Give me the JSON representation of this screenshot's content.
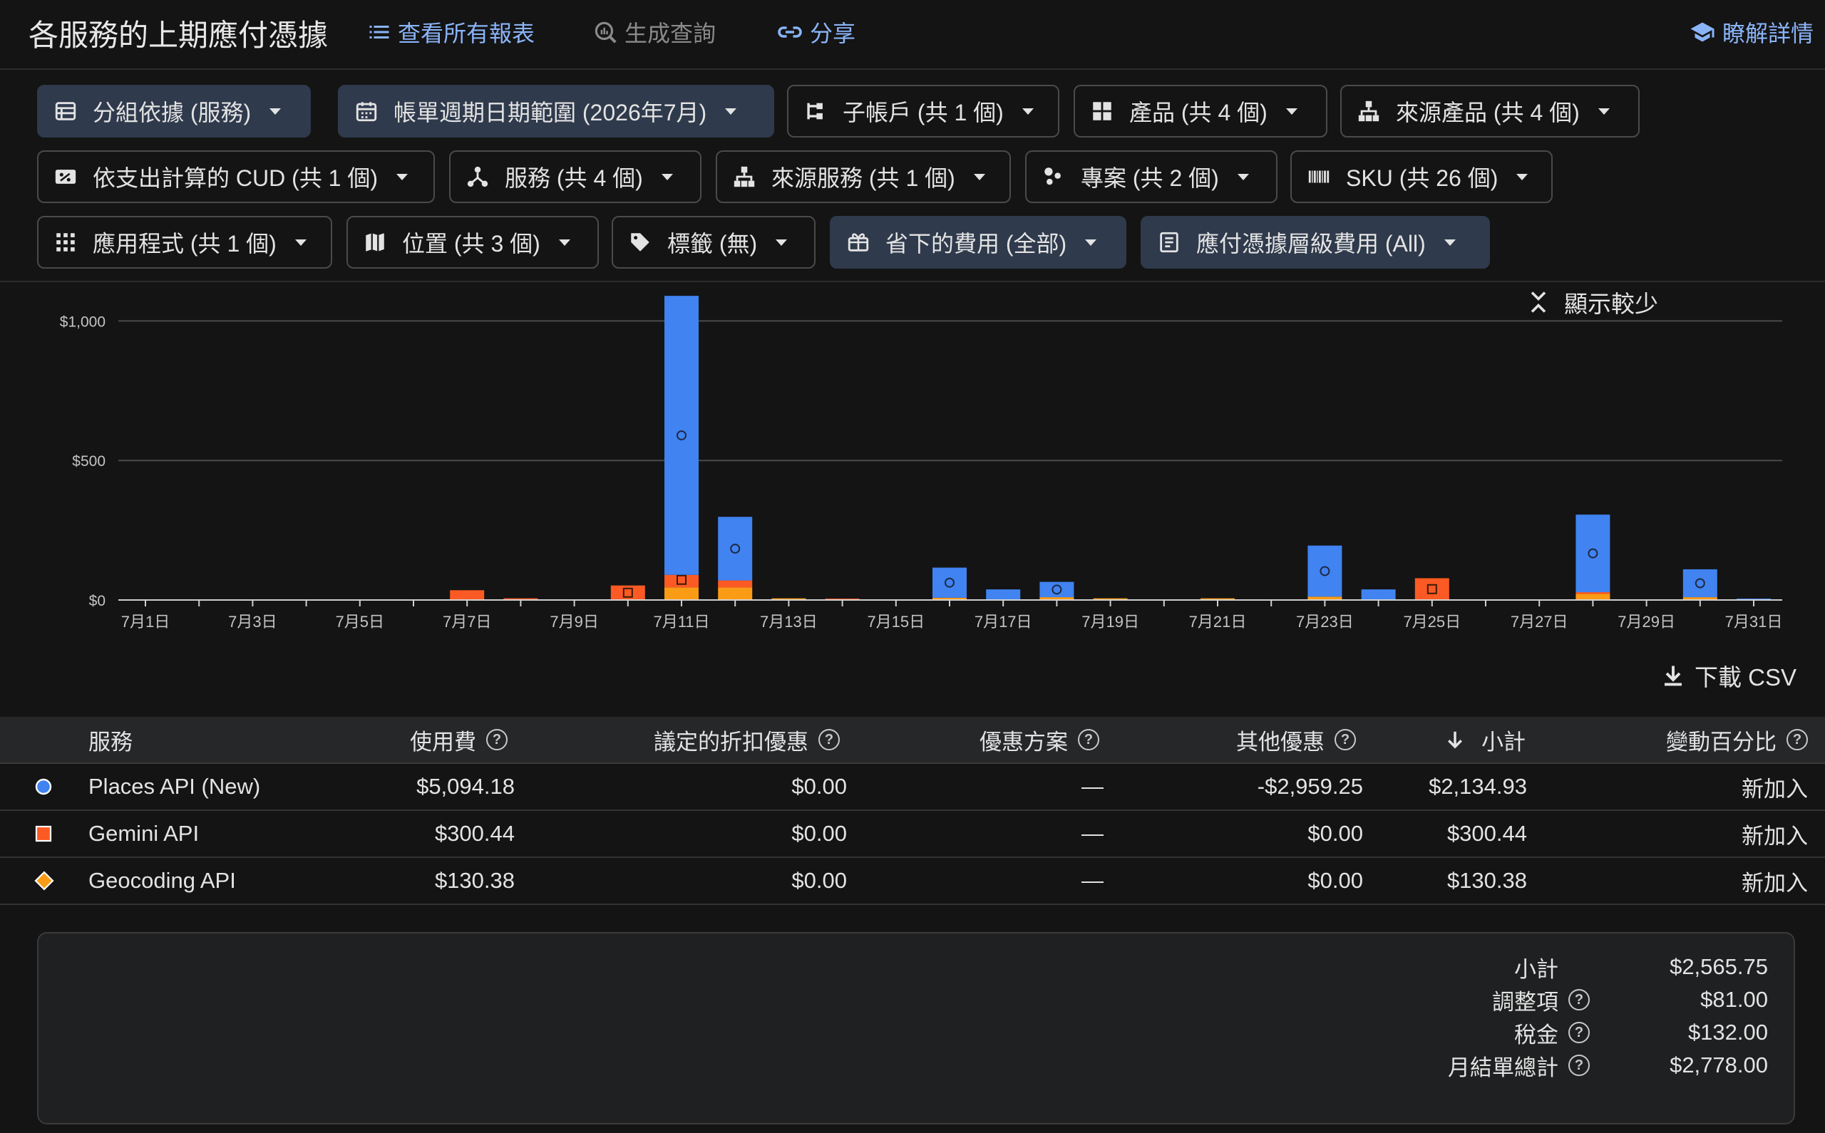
{
  "header": {
    "title": "各服務的上期應付憑據",
    "view_reports": "查看所有報表",
    "generate_query": "生成查詢",
    "share": "分享",
    "learn_more": "瞭解詳情"
  },
  "filters": {
    "group_by": "分組依據 (服務)",
    "date_range": "帳單週期日期範圍 (2026年7月)",
    "sub_accounts": "子帳戶 (共 1 個)",
    "products": "產品 (共 4 個)",
    "source_products": "來源產品 (共 4 個)",
    "spend_cud": "依支出計算的 CUD (共 1 個)",
    "services": "服務 (共 4 個)",
    "source_services": "來源服務 (共 1 個)",
    "projects": "專案 (共 2 個)",
    "skus": "SKU (共 26 個)",
    "apps": "應用程式 (共 1 個)",
    "locations": "位置 (共 3 個)",
    "labels": "標籤 (無)",
    "savings": "省下的費用 (全部)",
    "invoice_level": "應付憑據層級費用 (All)",
    "show_less": "顯示較少"
  },
  "chart_data": {
    "type": "bar",
    "stacked": true,
    "categories": [
      "7月1日",
      "7月2日",
      "7月3日",
      "7月4日",
      "7月5日",
      "7月6日",
      "7月7日",
      "7月8日",
      "7月9日",
      "7月10日",
      "7月11日",
      "7月12日",
      "7月13日",
      "7月14日",
      "7月15日",
      "7月16日",
      "7月17日",
      "7月18日",
      "7月19日",
      "7月20日",
      "7月21日",
      "7月22日",
      "7月23日",
      "7月24日",
      "7月25日",
      "7月26日",
      "7月27日",
      "7月28日",
      "7月29日",
      "7月30日",
      "7月31日"
    ],
    "tick_labels": [
      "7月1日",
      "7月3日",
      "7月5日",
      "7月7日",
      "7月9日",
      "7月11日",
      "7月13日",
      "7月15日",
      "7月17日",
      "7月19日",
      "7月21日",
      "7月23日",
      "7月25日",
      "7月27日",
      "7月29日",
      "7月31日"
    ],
    "ylim": [
      0,
      1070
    ],
    "yticks": [
      {
        "value": 0,
        "label": "$0"
      },
      {
        "value": 500,
        "label": "$500"
      },
      {
        "value": 1000,
        "label": "$1,000"
      }
    ],
    "series": [
      {
        "name": "Geocoding API",
        "color": "#fa9b16",
        "values": [
          0,
          0,
          0,
          0,
          0,
          0,
          0,
          0,
          0,
          0,
          45,
          45,
          6,
          0,
          0,
          8,
          0,
          10,
          6,
          0,
          6,
          0,
          12,
          0,
          0,
          0,
          0,
          22,
          0,
          10,
          0
        ]
      },
      {
        "name": "Gemini API",
        "color": "#fc5a24",
        "values": [
          0,
          0,
          0,
          0,
          0,
          0,
          35,
          6,
          0,
          52,
          45,
          25,
          0,
          5,
          0,
          0,
          0,
          0,
          0,
          0,
          0,
          0,
          0,
          0,
          78,
          0,
          0,
          6,
          0,
          0,
          0
        ]
      },
      {
        "name": "Places API (New)",
        "color": "#4083f1",
        "values": [
          0,
          0,
          0,
          0,
          0,
          0,
          0,
          0,
          0,
          0,
          1000,
          228,
          0,
          0,
          0,
          108,
          38,
          55,
          0,
          0,
          0,
          0,
          183,
          38,
          0,
          0,
          0,
          278,
          0,
          100,
          5
        ]
      }
    ],
    "grid": true
  },
  "download_csv": "下載 CSV",
  "table": {
    "headers": {
      "service": "服務",
      "usage": "使用費",
      "negotiated": "議定的折扣優惠",
      "promotions": "優惠方案",
      "other": "其他優惠",
      "subtotal": "小計",
      "change": "變動百分比"
    },
    "rows": [
      {
        "service": "Places API (New)",
        "usage": "$5,094.18",
        "negotiated": "$0.00",
        "promotions": "—",
        "other": "-$2,959.25",
        "subtotal": "$2,134.93",
        "change": "新加入",
        "color": "#4083f1",
        "marker": "circle"
      },
      {
        "service": "Gemini API",
        "usage": "$300.44",
        "negotiated": "$0.00",
        "promotions": "—",
        "other": "$0.00",
        "subtotal": "$300.44",
        "change": "新加入",
        "color": "#fc5a24",
        "marker": "square"
      },
      {
        "service": "Geocoding API",
        "usage": "$130.38",
        "negotiated": "$0.00",
        "promotions": "—",
        "other": "$0.00",
        "subtotal": "$130.38",
        "change": "新加入",
        "color": "#fa9b16",
        "marker": "diamond"
      }
    ]
  },
  "summary": {
    "subtotal_label": "小計",
    "subtotal": "$2,565.75",
    "adjust_label": "調整項",
    "adjust": "$81.00",
    "tax_label": "稅金",
    "tax": "$132.00",
    "total_label": "月結單總計",
    "total": "$2,778.00"
  }
}
